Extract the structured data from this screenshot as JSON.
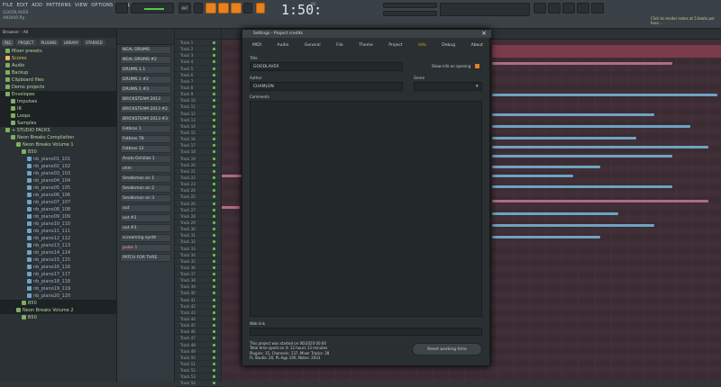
{
  "menu": [
    "FILE",
    "EDIT",
    "ADD",
    "PATTERNS",
    "VIEW",
    "OPTIONS",
    "TOOLS",
    "HELP"
  ],
  "song": {
    "name": "GOODLAVER",
    "sub": "ANDAIR.flp"
  },
  "transport": {
    "mode_label": "PAT",
    "song_label": "SONG",
    "time": "1:50:",
    "time_small": "00",
    "time_unit": "B:S:T",
    "hint": "Click to render notes at 5 beats per hour…"
  },
  "browser": {
    "header": "Browser - All",
    "tabs": [
      {
        "label": "ALL",
        "active": true
      },
      {
        "label": "PROJECT"
      },
      {
        "label": "PLUGINS"
      },
      {
        "label": "LIBRARY"
      },
      {
        "label": "STARRED"
      }
    ],
    "items": [
      {
        "label": "Mixer presets",
        "type": "folder",
        "level": 1
      },
      {
        "label": "Scores",
        "type": "sel",
        "level": 1
      },
      {
        "label": "Audio",
        "type": "folder",
        "level": 1
      },
      {
        "label": "Backup",
        "type": "folder",
        "level": 1
      },
      {
        "label": "Clipboard files",
        "type": "folder",
        "level": 1
      },
      {
        "label": "Demo projects",
        "type": "folder",
        "level": 1
      },
      {
        "label": "Envelopes",
        "type": "folder",
        "level": 1,
        "hl": true
      },
      {
        "label": "Impulses",
        "type": "folder",
        "level": 2,
        "hl": true
      },
      {
        "label": "IR",
        "type": "folder",
        "level": 2,
        "hl": true
      },
      {
        "label": "Loops",
        "type": "folder",
        "level": 2,
        "hl": true
      },
      {
        "label": "Samples",
        "type": "folder",
        "level": 2,
        "hl": true
      },
      {
        "label": "+ STUDIO PACKS",
        "type": "folder",
        "level": 1
      },
      {
        "label": "Neon Breaks Compilation",
        "type": "folder",
        "level": 2
      },
      {
        "label": "Neon Breaks Volume 1",
        "type": "folder",
        "level": 3
      },
      {
        "label": "B50",
        "type": "folder",
        "level": 4
      },
      {
        "label": "nb_piano01_101",
        "type": "file",
        "level": 5
      },
      {
        "label": "nb_piano02_102",
        "type": "file",
        "level": 5
      },
      {
        "label": "nb_piano03_103",
        "type": "file",
        "level": 5
      },
      {
        "label": "nb_piano04_104",
        "type": "file",
        "level": 5
      },
      {
        "label": "nb_piano05_105",
        "type": "file",
        "level": 5
      },
      {
        "label": "nb_piano06_106",
        "type": "file",
        "level": 5
      },
      {
        "label": "nb_piano07_107",
        "type": "file",
        "level": 5
      },
      {
        "label": "nb_piano08_108",
        "type": "file",
        "level": 5
      },
      {
        "label": "nb_piano09_109",
        "type": "file",
        "level": 5
      },
      {
        "label": "nb_piano10_110",
        "type": "file",
        "level": 5
      },
      {
        "label": "nb_piano11_111",
        "type": "file",
        "level": 5
      },
      {
        "label": "nb_piano12_112",
        "type": "file",
        "level": 5
      },
      {
        "label": "nb_piano13_113",
        "type": "file",
        "level": 5
      },
      {
        "label": "nb_piano14_114",
        "type": "file",
        "level": 5
      },
      {
        "label": "nb_piano15_115",
        "type": "file",
        "level": 5
      },
      {
        "label": "nb_piano16_116",
        "type": "file",
        "level": 5
      },
      {
        "label": "nb_piano17_117",
        "type": "file",
        "level": 5
      },
      {
        "label": "nb_piano18_118",
        "type": "file",
        "level": 5
      },
      {
        "label": "nb_piano19_119",
        "type": "file",
        "level": 5
      },
      {
        "label": "nb_piano20_120",
        "type": "file",
        "level": 5
      },
      {
        "label": "B50",
        "type": "folder",
        "level": 4,
        "hl": true
      },
      {
        "label": "Neon Breaks Volume 2",
        "type": "folder",
        "level": 3,
        "hl": true
      },
      {
        "label": "B50",
        "type": "folder",
        "level": 4
      }
    ]
  },
  "channels": [
    {
      "label": "NEAL DRUMS"
    },
    {
      "label": "NEAL DRUMS #2"
    },
    {
      "label": "DRUMS 1.1"
    },
    {
      "label": "DRUMS 1 #2"
    },
    {
      "label": "DRUMS 1 #3"
    },
    {
      "label": "BRICKSTEAM 2013"
    },
    {
      "label": "BRICKSTEAM 2013 #2"
    },
    {
      "label": "BRICKSTEAM 2013 #3"
    },
    {
      "label": "Fatbros 1"
    },
    {
      "label": "Fatbros 78"
    },
    {
      "label": "Fatbros 12"
    },
    {
      "label": "Analo Ochillat 1"
    },
    {
      "label": "ohm"
    },
    {
      "label": "Smalkman on 1"
    },
    {
      "label": "Smalkman on 2"
    },
    {
      "label": "Smalkman on 3"
    },
    {
      "label": "out"
    },
    {
      "label": "out #2"
    },
    {
      "label": "out #3"
    },
    {
      "label": "screaming synth"
    },
    {
      "label": "pulse 1",
      "red": true
    },
    {
      "label": "PATCH FOR THRE"
    }
  ],
  "mixer_tracks": [
    "Track 1",
    "Track 2",
    "Track 3",
    "Track 4",
    "Track 5",
    "Track 6",
    "Track 7",
    "Track 8",
    "Track 9",
    "Track 10",
    "Track 11",
    "Track 12",
    "Track 13",
    "Track 14",
    "Track 15",
    "Track 16",
    "Track 17",
    "Track 18",
    "Track 19",
    "Track 20",
    "Track 21",
    "Track 22",
    "Track 23",
    "Track 24",
    "Track 25",
    "Track 26",
    "Track 27",
    "Track 28",
    "Track 29",
    "Track 30",
    "Track 31",
    "Track 32",
    "Track 33",
    "Track 34",
    "Track 35",
    "Track 36",
    "Track 37",
    "Track 38",
    "Track 39",
    "Track 40",
    "Track 41",
    "Track 42",
    "Track 43",
    "Track 44",
    "Track 45",
    "Track 46",
    "Track 47",
    "Track 48",
    "Track 49",
    "Track 50",
    "Track 51",
    "Track 52",
    "Track 53",
    "Track 54"
  ],
  "dialog": {
    "title": "Settings - Project credits",
    "tabs": [
      {
        "label": "MIDI"
      },
      {
        "label": "Audio"
      },
      {
        "label": "General"
      },
      {
        "label": "File"
      },
      {
        "label": "Theme"
      },
      {
        "label": "Project"
      },
      {
        "label": "Info",
        "active": true
      },
      {
        "label": "Debug"
      },
      {
        "label": "About"
      }
    ],
    "title_label": "Title",
    "title_value": "GOODLAVER",
    "author_label": "Author",
    "author_value": "CHAMLON",
    "genre_label": "Genre",
    "genre_value": "",
    "show_info_label": "Show info on opening",
    "comments_label": "Comments",
    "weblink_label": "Web link",
    "info_lines": [
      "This project was started on 06/2020 00:00",
      "Total time spent on it: 12 hours 13 minutes",
      "Plugins: 15, Channels: 137, Mixer Tracks: 28",
      "FL Studio: 20, PL-App 100, Notes: 2033"
    ],
    "reset_button": "Reset working time"
  },
  "colors": {
    "accent": "#e8821d",
    "clip_pink": "#b06b84",
    "clip_blue": "#6ea3c4",
    "green": "#5fc34a"
  }
}
